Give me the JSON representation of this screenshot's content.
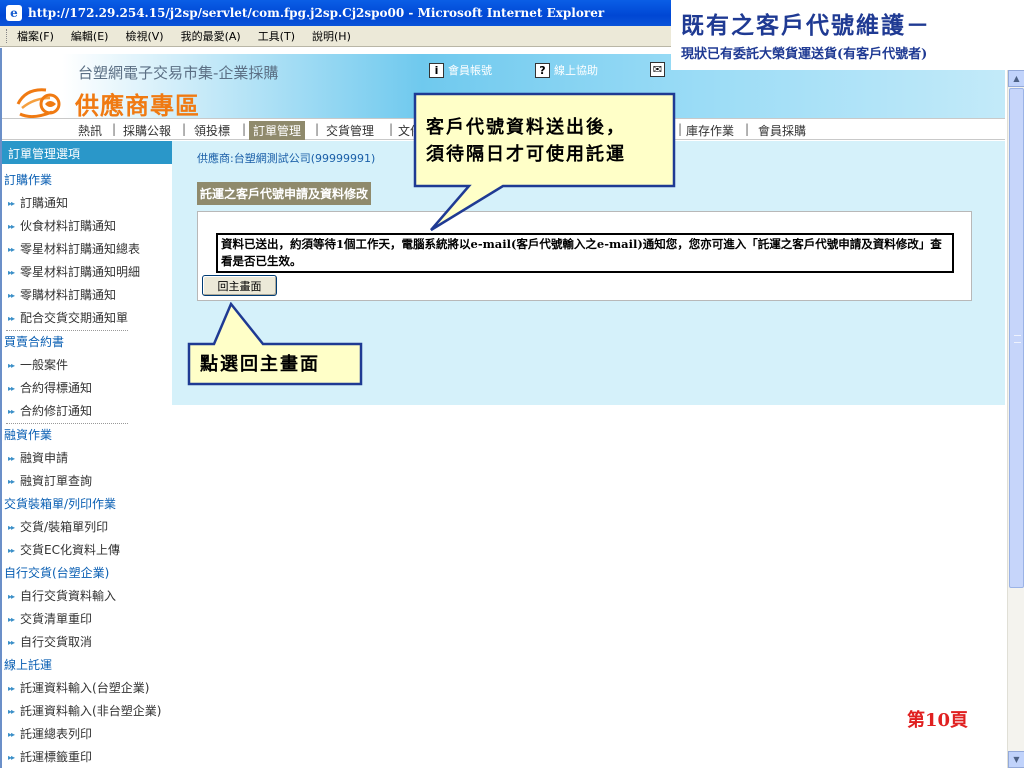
{
  "window": {
    "title": "http://172.29.254.15/j2sp/servlet/com.fpg.j2sp.Cj2spo00 - Microsoft Internet Explorer",
    "menu": [
      "檔案(F)",
      "編輯(E)",
      "檢視(V)",
      "我的最愛(A)",
      "工具(T)",
      "說明(H)"
    ]
  },
  "slide": {
    "title": "既有之客戶代號維護－",
    "subtitle": "現狀已有委託大榮貨運送貨(有客戶代號者)",
    "page_number": "第10頁"
  },
  "header": {
    "site_name": "台塑網電子交易市集-企業採購",
    "links": [
      {
        "icon": "i",
        "label": "會員帳號"
      },
      {
        "icon": "?",
        "label": "線上協助"
      },
      {
        "icon": "✉",
        "label": ""
      }
    ],
    "portal_title": "供應商專區"
  },
  "nav": {
    "items": [
      "熱訊",
      "採購公報",
      "領投標",
      "訂單管理",
      "交貨管理",
      "文件",
      "庫存作業",
      "會員採購"
    ],
    "active": "訂單管理"
  },
  "sidebar": {
    "header": "訂單管理選項",
    "groups": [
      {
        "title": "訂購作業",
        "items": [
          "訂購通知",
          "伙食材料訂購通知",
          "零星材料訂購通知總表",
          "零星材料訂購通知明細",
          "零購材料訂購通知",
          "配合交貨交期通知單"
        ]
      },
      {
        "title": "買賣合約書",
        "items": [
          "一般案件",
          "合約得標通知",
          "合約修訂通知"
        ]
      },
      {
        "title": "融資作業",
        "items": [
          "融資申請",
          "融資訂單查詢"
        ]
      },
      {
        "title": "交貨裝箱單/列印作業",
        "items": [
          "交貨/裝箱單列印",
          "交貨EC化資料上傳"
        ]
      },
      {
        "title": "自行交貨(台塑企業)",
        "items": [
          "自行交貨資料輸入",
          "交貨清單重印",
          "自行交貨取消"
        ]
      },
      {
        "title": "線上託運",
        "items": [
          "託運資料輸入(台塑企業)",
          "託運資料輸入(非台塑企業)",
          "託運總表列印",
          "託運標籤重印"
        ]
      }
    ]
  },
  "content": {
    "supplier": "供應商:台塑網測試公司(99999991)",
    "panel_title": "託運之客戶代號申請及資料修改",
    "message": "資料已送出，約須等待1個工作天，電腦系統將以e-mail(客戶代號輸入之e-mail)通知您，您亦可進入「託運之客戶代號申請及資料修改」查看是否已生效。",
    "home_button": "回主畫面"
  },
  "callouts": {
    "top": [
      "客戶代號資料送出後，",
      "須待隔日才可使用託運"
    ],
    "bottom": "點選回主畫面"
  },
  "colors": {
    "callout_fill": "#ffffc8",
    "callout_border": "#1f3a93",
    "sidebar_header": "#2a97c9",
    "active_tab": "#8f8a6c",
    "portal_title": "#f07a12",
    "page_number": "#e02020"
  }
}
